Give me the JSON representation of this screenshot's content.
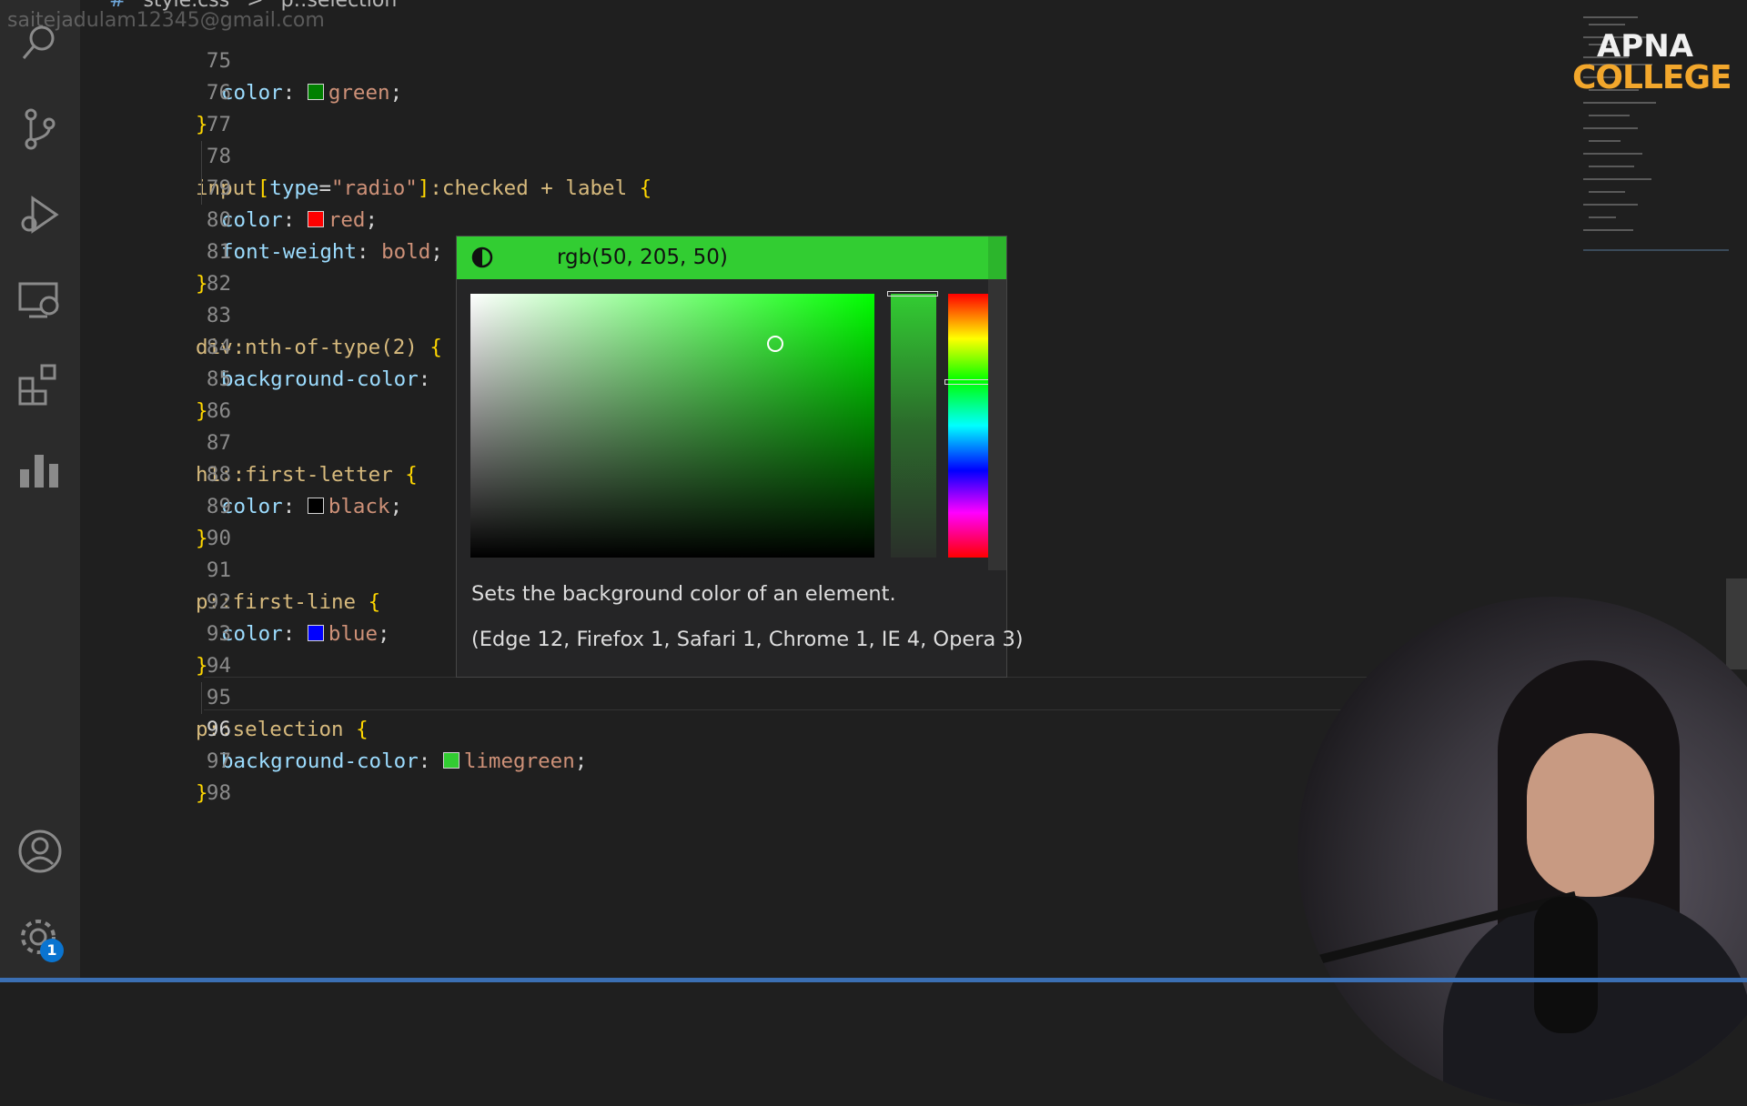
{
  "watermark": "saitejadulam12345@gmail.com",
  "breadcrumb": {
    "hash": "#",
    "file": "style.css",
    "sep": ">",
    "symbol": "p::selection"
  },
  "activity_bar": {
    "icons": [
      "search-icon",
      "source-control-icon",
      "run-debug-icon",
      "remote-explorer-icon",
      "extensions-icon",
      "chart-icon",
      "account-icon",
      "settings-gear-icon"
    ],
    "settings_badge": "1"
  },
  "editor": {
    "lines": [
      {
        "num": "75",
        "text": "color: green;"
      },
      {
        "num": "76",
        "text": "}"
      },
      {
        "num": "77",
        "text": ""
      },
      {
        "num": "78",
        "text": "input[type=\"radio\"]:checked + label {"
      },
      {
        "num": "79",
        "text": "color: red;"
      },
      {
        "num": "80",
        "text": "font-weight: bold;"
      },
      {
        "num": "81",
        "text": "}"
      },
      {
        "num": "82",
        "text": ""
      },
      {
        "num": "83",
        "text": "div:nth-of-type(2) {"
      },
      {
        "num": "84",
        "text": "background-color:"
      },
      {
        "num": "85",
        "text": "}"
      },
      {
        "num": "86",
        "text": ""
      },
      {
        "num": "87",
        "text": "h1::first-letter {"
      },
      {
        "num": "88",
        "text": "color: black;"
      },
      {
        "num": "89",
        "text": "}"
      },
      {
        "num": "90",
        "text": ""
      },
      {
        "num": "91",
        "text": "p::first-line {"
      },
      {
        "num": "92",
        "text": "color: blue;"
      },
      {
        "num": "93",
        "text": "}"
      },
      {
        "num": "94",
        "text": ""
      },
      {
        "num": "95",
        "text": "p::selection {"
      },
      {
        "num": "96",
        "text": "background-color: limegreen;"
      },
      {
        "num": "97",
        "text": "}"
      },
      {
        "num": "98",
        "text": ""
      }
    ],
    "tokens": {
      "l75_prop": "color",
      "l75_val": "green",
      "l78_sel": "input",
      "l78_attr": "type",
      "l78_str": "\"radio\"",
      "l78_rest": ":checked + label",
      "l79_prop": "color",
      "l79_val": "red",
      "l80_prop": "font-weight",
      "l80_val": "bold",
      "l83_sel": "div:nth-of-type(2)",
      "l84_prop": "background-color",
      "l87_sel": "h1::first-letter",
      "l88_prop": "color",
      "l88_val": "black",
      "l91_sel": "p::first-line",
      "l92_prop": "color",
      "l92_val": "blue",
      "l95_sel": "p::selection",
      "l96_prop": "background-color",
      "l96_val": "limegreen"
    },
    "swatch_colors": {
      "green": "#008000",
      "red": "#ff0000",
      "black": "#000000",
      "blue": "#0000ff",
      "limegreen": "#32cd32"
    }
  },
  "color_picker": {
    "value": "rgb(50, 205, 50)",
    "description": "Sets the background color of an element.",
    "compat": "(Edge 12, Firefox 1, Safari 1, Chrome 1, IE 4, Opera 3)",
    "hue_fraction": 0.33,
    "saturation": 0.76,
    "brightness": 0.8
  },
  "logo": {
    "line1": "APNA",
    "line2": "COLLEGE"
  }
}
